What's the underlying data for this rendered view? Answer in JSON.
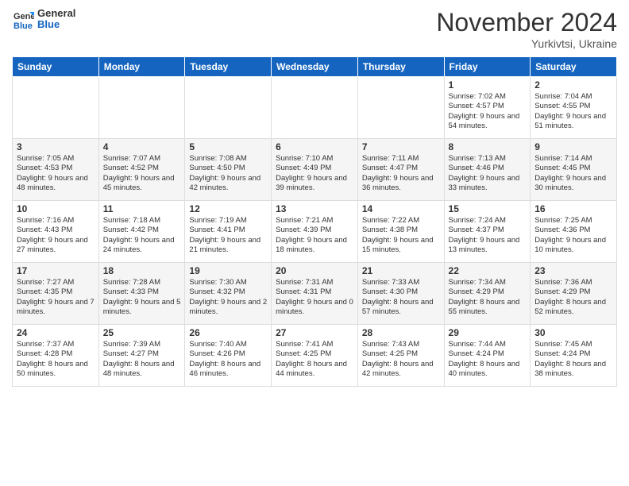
{
  "logo": {
    "line1": "General",
    "line2": "Blue"
  },
  "header": {
    "title": "November 2024",
    "location": "Yurkivtsi, Ukraine"
  },
  "weekdays": [
    "Sunday",
    "Monday",
    "Tuesday",
    "Wednesday",
    "Thursday",
    "Friday",
    "Saturday"
  ],
  "weeks": [
    [
      {
        "day": "",
        "info": ""
      },
      {
        "day": "",
        "info": ""
      },
      {
        "day": "",
        "info": ""
      },
      {
        "day": "",
        "info": ""
      },
      {
        "day": "",
        "info": ""
      },
      {
        "day": "1",
        "info": "Sunrise: 7:02 AM\nSunset: 4:57 PM\nDaylight: 9 hours and 54 minutes."
      },
      {
        "day": "2",
        "info": "Sunrise: 7:04 AM\nSunset: 4:55 PM\nDaylight: 9 hours and 51 minutes."
      }
    ],
    [
      {
        "day": "3",
        "info": "Sunrise: 7:05 AM\nSunset: 4:53 PM\nDaylight: 9 hours and 48 minutes."
      },
      {
        "day": "4",
        "info": "Sunrise: 7:07 AM\nSunset: 4:52 PM\nDaylight: 9 hours and 45 minutes."
      },
      {
        "day": "5",
        "info": "Sunrise: 7:08 AM\nSunset: 4:50 PM\nDaylight: 9 hours and 42 minutes."
      },
      {
        "day": "6",
        "info": "Sunrise: 7:10 AM\nSunset: 4:49 PM\nDaylight: 9 hours and 39 minutes."
      },
      {
        "day": "7",
        "info": "Sunrise: 7:11 AM\nSunset: 4:47 PM\nDaylight: 9 hours and 36 minutes."
      },
      {
        "day": "8",
        "info": "Sunrise: 7:13 AM\nSunset: 4:46 PM\nDaylight: 9 hours and 33 minutes."
      },
      {
        "day": "9",
        "info": "Sunrise: 7:14 AM\nSunset: 4:45 PM\nDaylight: 9 hours and 30 minutes."
      }
    ],
    [
      {
        "day": "10",
        "info": "Sunrise: 7:16 AM\nSunset: 4:43 PM\nDaylight: 9 hours and 27 minutes."
      },
      {
        "day": "11",
        "info": "Sunrise: 7:18 AM\nSunset: 4:42 PM\nDaylight: 9 hours and 24 minutes."
      },
      {
        "day": "12",
        "info": "Sunrise: 7:19 AM\nSunset: 4:41 PM\nDaylight: 9 hours and 21 minutes."
      },
      {
        "day": "13",
        "info": "Sunrise: 7:21 AM\nSunset: 4:39 PM\nDaylight: 9 hours and 18 minutes."
      },
      {
        "day": "14",
        "info": "Sunrise: 7:22 AM\nSunset: 4:38 PM\nDaylight: 9 hours and 15 minutes."
      },
      {
        "day": "15",
        "info": "Sunrise: 7:24 AM\nSunset: 4:37 PM\nDaylight: 9 hours and 13 minutes."
      },
      {
        "day": "16",
        "info": "Sunrise: 7:25 AM\nSunset: 4:36 PM\nDaylight: 9 hours and 10 minutes."
      }
    ],
    [
      {
        "day": "17",
        "info": "Sunrise: 7:27 AM\nSunset: 4:35 PM\nDaylight: 9 hours and 7 minutes."
      },
      {
        "day": "18",
        "info": "Sunrise: 7:28 AM\nSunset: 4:33 PM\nDaylight: 9 hours and 5 minutes."
      },
      {
        "day": "19",
        "info": "Sunrise: 7:30 AM\nSunset: 4:32 PM\nDaylight: 9 hours and 2 minutes."
      },
      {
        "day": "20",
        "info": "Sunrise: 7:31 AM\nSunset: 4:31 PM\nDaylight: 9 hours and 0 minutes."
      },
      {
        "day": "21",
        "info": "Sunrise: 7:33 AM\nSunset: 4:30 PM\nDaylight: 8 hours and 57 minutes."
      },
      {
        "day": "22",
        "info": "Sunrise: 7:34 AM\nSunset: 4:29 PM\nDaylight: 8 hours and 55 minutes."
      },
      {
        "day": "23",
        "info": "Sunrise: 7:36 AM\nSunset: 4:29 PM\nDaylight: 8 hours and 52 minutes."
      }
    ],
    [
      {
        "day": "24",
        "info": "Sunrise: 7:37 AM\nSunset: 4:28 PM\nDaylight: 8 hours and 50 minutes."
      },
      {
        "day": "25",
        "info": "Sunrise: 7:39 AM\nSunset: 4:27 PM\nDaylight: 8 hours and 48 minutes."
      },
      {
        "day": "26",
        "info": "Sunrise: 7:40 AM\nSunset: 4:26 PM\nDaylight: 8 hours and 46 minutes."
      },
      {
        "day": "27",
        "info": "Sunrise: 7:41 AM\nSunset: 4:25 PM\nDaylight: 8 hours and 44 minutes."
      },
      {
        "day": "28",
        "info": "Sunrise: 7:43 AM\nSunset: 4:25 PM\nDaylight: 8 hours and 42 minutes."
      },
      {
        "day": "29",
        "info": "Sunrise: 7:44 AM\nSunset: 4:24 PM\nDaylight: 8 hours and 40 minutes."
      },
      {
        "day": "30",
        "info": "Sunrise: 7:45 AM\nSunset: 4:24 PM\nDaylight: 8 hours and 38 minutes."
      }
    ]
  ]
}
